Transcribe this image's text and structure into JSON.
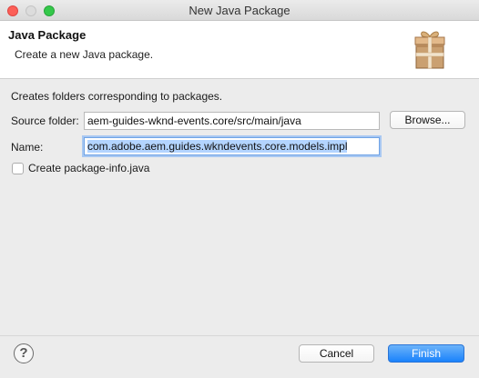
{
  "window": {
    "title": "New Java Package"
  },
  "banner": {
    "heading": "Java Package",
    "subtext": "Create a new Java package.",
    "icon": "package-icon"
  },
  "form": {
    "description": "Creates folders corresponding to packages.",
    "source_folder_label": "Source folder:",
    "source_folder_value": "aem-guides-wknd-events.core/src/main/java",
    "browse_label": "Browse...",
    "name_label": "Name:",
    "name_value": "com.adobe.aem.guides.wkndevents.core.models.impl",
    "create_package_info_label": "Create package-info.java",
    "create_package_info_checked": false
  },
  "footer": {
    "help_icon": "help-icon",
    "help_glyph": "?",
    "cancel_label": "Cancel",
    "finish_label": "Finish"
  },
  "colors": {
    "accent": "#1a82fb",
    "focus_ring": "#a8c8f2",
    "selection": "#b3d4ff",
    "close": "#fc5f57",
    "maximize": "#34c84a"
  }
}
